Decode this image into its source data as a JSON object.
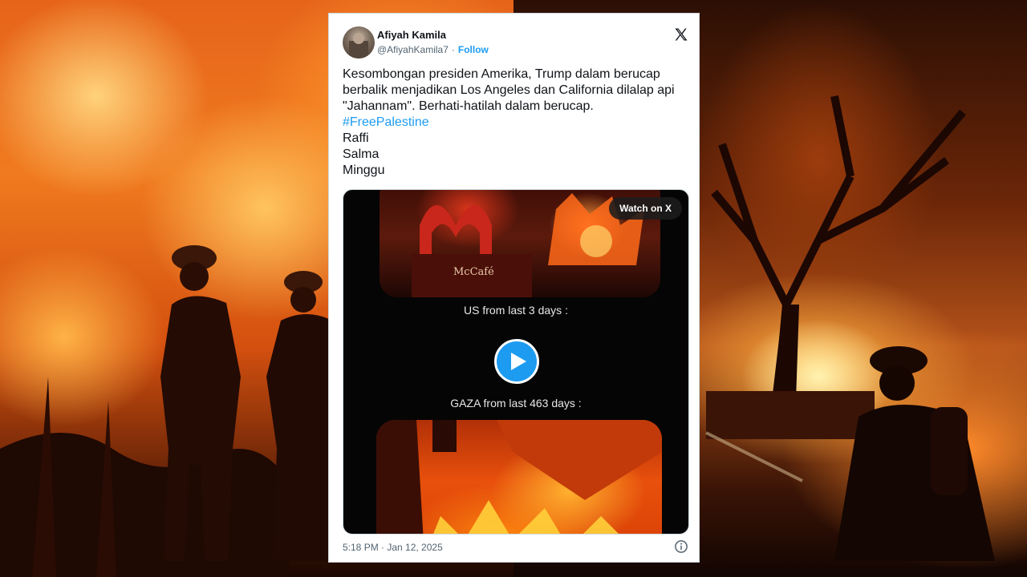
{
  "tweet": {
    "author_name": "Afiyah Kamila",
    "handle": "@AfiyahKamila7",
    "separator": "·",
    "follow_label": "Follow",
    "text_lines": [
      "Kesombongan presiden Amerika, Trump dalam berucap",
      "berbalik menjadikan Los Angeles dan California dilalap api",
      "\"Jahannam\". Berhati-hatilah dalam berucap."
    ],
    "hashtag": "#FreePalestine",
    "extra_lines": [
      "Raffi",
      "Salma",
      "Minggu"
    ],
    "timestamp": "5:18 PM · Jan 12, 2025"
  },
  "video": {
    "watch_label": "Watch on X",
    "caption_top": "US from last 3 days :",
    "caption_bottom": "GAZA from last 463 days :",
    "sign_text": "McCafé"
  },
  "icons": {
    "x_logo": "x-logo-icon",
    "play": "play-icon",
    "info": "info-icon"
  },
  "colors": {
    "link": "#1d9bf0",
    "text": "#0f1419",
    "muted": "#536471"
  }
}
